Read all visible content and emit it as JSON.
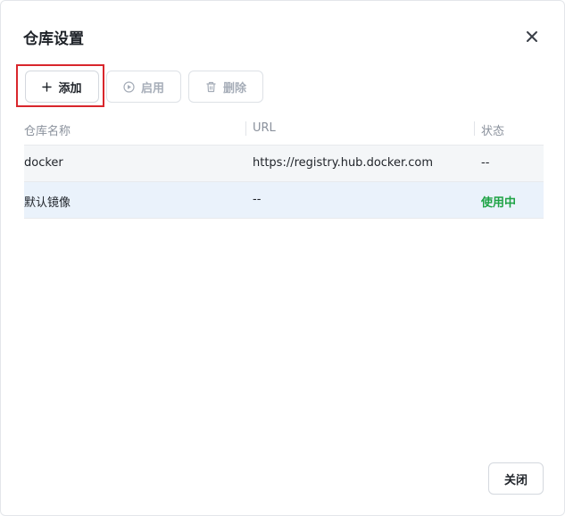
{
  "dialog": {
    "title": "仓库设置",
    "close_icon": "close-icon"
  },
  "toolbar": {
    "add_label": "添加",
    "add_icon": "plus-icon",
    "enable_label": "启用",
    "enable_icon": "play-circle-icon",
    "delete_label": "删除",
    "delete_icon": "trash-icon"
  },
  "table": {
    "columns": [
      "仓库名称",
      "URL",
      "状态"
    ],
    "rows": [
      {
        "name": "docker",
        "url": "https://registry.hub.docker.com",
        "status": "--"
      },
      {
        "name": "默认镜像",
        "url": "--",
        "status": "使用中"
      }
    ]
  },
  "footer": {
    "close_label": "关闭"
  },
  "colors": {
    "highlight": "#d9262c",
    "status_active": "#1ea345",
    "selected_row": "#eaf2fb"
  }
}
